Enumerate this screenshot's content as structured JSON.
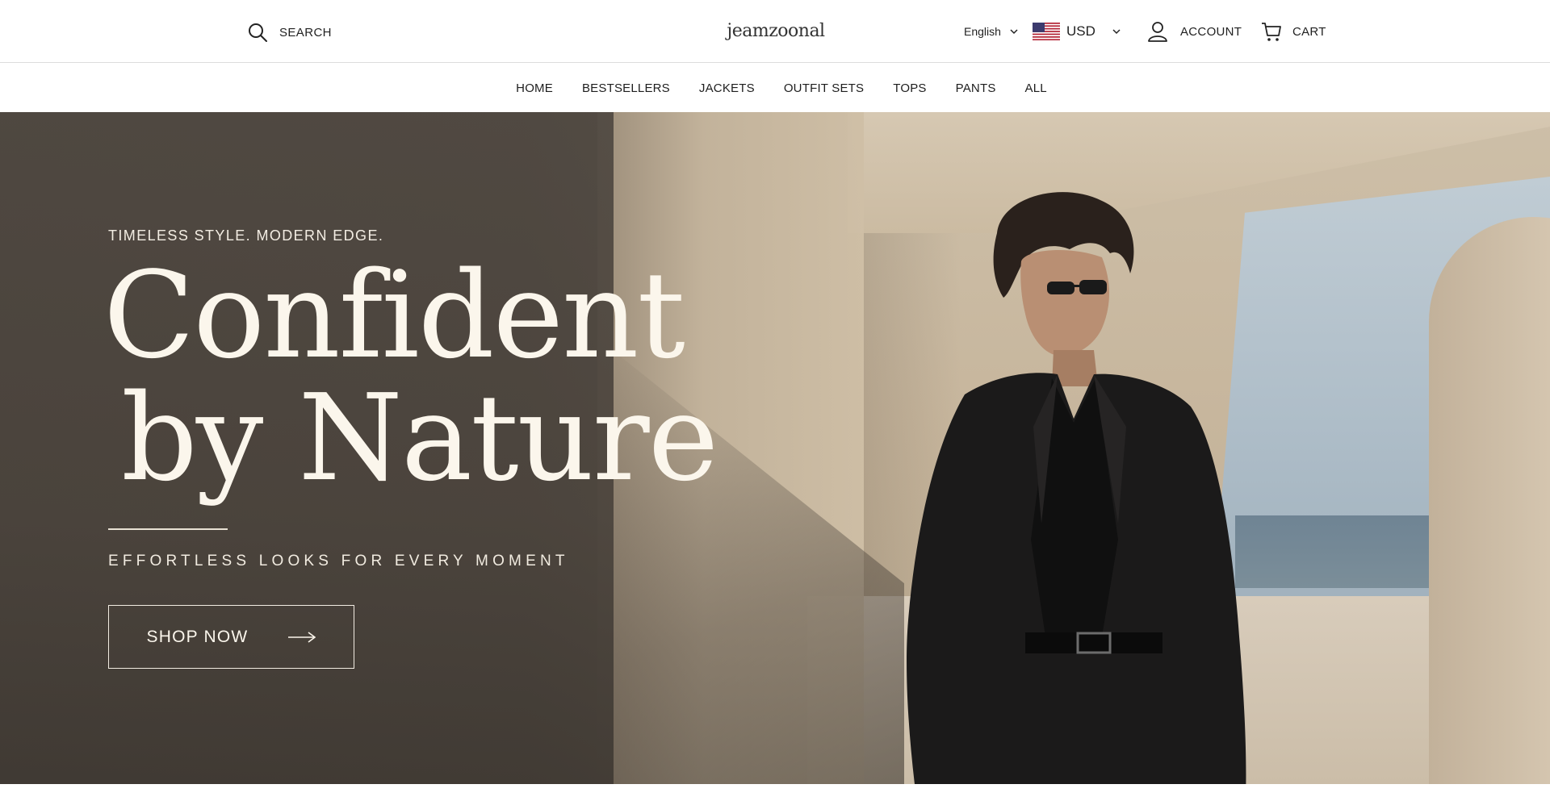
{
  "header": {
    "search_label": "SEARCH",
    "logo_text": "jeamzoonal",
    "language": "English",
    "currency": "USD",
    "account_label": "ACCOUNT",
    "cart_label": "CART"
  },
  "nav": {
    "items": [
      "HOME",
      "BESTSELLERS",
      "JACKETS",
      "OUTFIT SETS",
      "TOPS",
      "PANTS",
      "ALL"
    ]
  },
  "hero": {
    "tagline": "TIMELESS STYLE. MODERN EDGE.",
    "headline_line1": "Confident",
    "headline_line2": "by Nature",
    "subline": "EFFORTLESS LOOKS FOR EVERY MOMENT",
    "cta_label": "SHOP NOW"
  },
  "icons": {
    "search": "search-icon",
    "account": "user-icon",
    "cart": "cart-icon",
    "flag": "us-flag-icon",
    "chevron": "chevron-down-icon",
    "arrow": "arrow-right-icon"
  },
  "colors": {
    "header_bg": "#ffffff",
    "hero_text": "#fbf6ec",
    "nav_text": "#1e1e1e"
  }
}
